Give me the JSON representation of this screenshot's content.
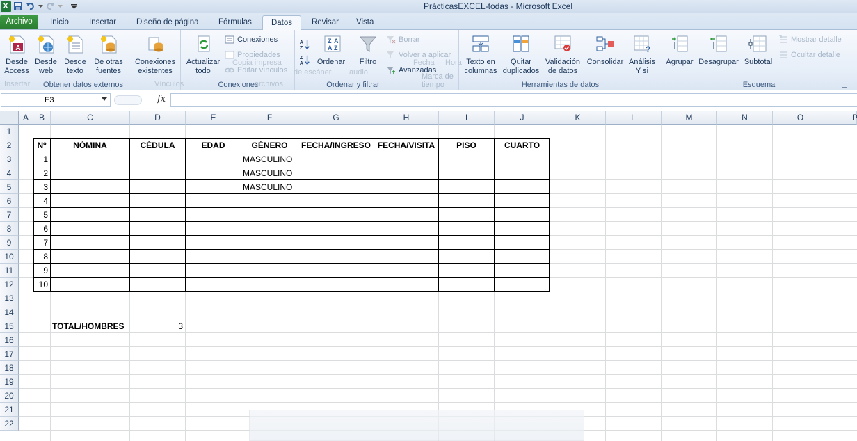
{
  "window": {
    "title": "PrácticasEXCEL-todas  -  Microsoft Excel",
    "app_logo": "X"
  },
  "tabs": [
    {
      "label": "Archivo"
    },
    {
      "label": "Inicio"
    },
    {
      "label": "Insertar"
    },
    {
      "label": "Diseño de página"
    },
    {
      "label": "Fórmulas"
    },
    {
      "label": "Datos"
    },
    {
      "label": "Revisar"
    },
    {
      "label": "Vista"
    }
  ],
  "ribbon": {
    "external": {
      "label": "Obtener datos externos",
      "access_1": "Desde",
      "access_2": "Access",
      "web_1": "Desde",
      "web_2": "web",
      "text_1": "Desde",
      "text_2": "texto",
      "other_1": "De otras",
      "other_2": "fuentes",
      "existing_1": "Conexiones",
      "existing_2": "existentes"
    },
    "connections": {
      "label": "Conexiones",
      "refresh_1": "Actualizar",
      "refresh_2": "todo",
      "conexiones": "Conexiones",
      "propiedades": "Propiedades",
      "editar": "Editar vínculos"
    },
    "sort": {
      "label": "Ordenar y filtrar",
      "ordenar": "Ordenar",
      "filtro": "Filtro",
      "borrar": "Borrar",
      "volver": "Volver a aplicar",
      "avanzadas": "Avanzadas"
    },
    "tools": {
      "label": "Herramientas de datos",
      "texto_1": "Texto en",
      "texto_2": "columnas",
      "quitar_1": "Quitar",
      "quitar_2": "duplicados",
      "valid_1": "Validación",
      "valid_2": "de datos",
      "consolidar": "Consolidar",
      "analisis_1": "Análisis",
      "analisis_2": "Y si"
    },
    "outline": {
      "label": "Esquema",
      "agrupar": "Agrupar",
      "desagrupar": "Desagrupar",
      "subtotal": "Subtotal",
      "mostrar": "Mostrar detalle",
      "ocultar": "Ocultar detalle"
    },
    "ghost": {
      "insertar": "Insertar",
      "vinculos": "Vínculos",
      "marca": "Marca de tiempo",
      "copia": "Copia impresa",
      "archivos": "archivos",
      "de_escaner": "de escáner",
      "audio": "audio",
      "fecha": "Fecha",
      "hora": "Hora"
    }
  },
  "formula_bar": {
    "name_box": "E3",
    "fx": "fx",
    "value": ""
  },
  "columns": [
    "A",
    "B",
    "C",
    "D",
    "E",
    "F",
    "G",
    "H",
    "I",
    "J",
    "K",
    "L",
    "M",
    "N",
    "O",
    "P"
  ],
  "rows": [
    "1",
    "2",
    "3",
    "4",
    "5",
    "6",
    "7",
    "8",
    "9",
    "10",
    "11",
    "12",
    "13",
    "14",
    "15",
    "16",
    "17",
    "18",
    "19",
    "20",
    "21",
    "22"
  ],
  "table": {
    "headers": [
      "Nº",
      "NÓMINA",
      "CÉDULA",
      "EDAD",
      "GÉNERO",
      "FECHA/INGRESO",
      "FECHA/VISITA",
      "PISO",
      "CUARTO"
    ],
    "numbers": [
      "1",
      "2",
      "3",
      "4",
      "5",
      "6",
      "7",
      "8",
      "9",
      "10"
    ],
    "genero": [
      "MASCULINO",
      "MASCULINO",
      "MASCULINO"
    ]
  },
  "total": {
    "label": "TOTAL/HOMBRES",
    "value": "3"
  }
}
